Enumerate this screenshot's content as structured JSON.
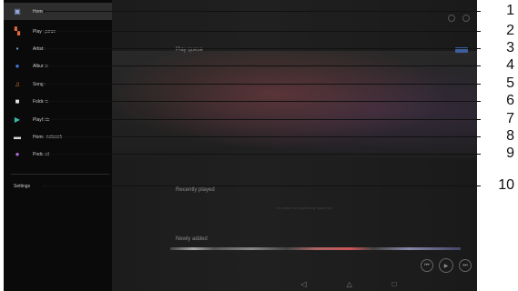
{
  "sidebar": {
    "items": [
      {
        "label": "Home",
        "icon": "home-icon",
        "color": "#8fa7d9",
        "glyph": "▣",
        "active": true
      },
      {
        "label": "Play queue",
        "icon": "play-queue-icon",
        "color": "#e06a3a",
        "glyph": "▚"
      },
      {
        "label": "Artists",
        "icon": "artists-icon",
        "color": "#7aa0e0",
        "glyph": "▪"
      },
      {
        "label": "Albums",
        "icon": "albums-icon",
        "color": "#3f7bd9",
        "glyph": "●"
      },
      {
        "label": "Songs",
        "icon": "songs-icon",
        "color": "#e07a2a",
        "glyph": "♫"
      },
      {
        "label": "Folders",
        "icon": "folders-icon",
        "color": "#e6e6e6",
        "glyph": "■"
      },
      {
        "label": "Playlists",
        "icon": "playlists-icon",
        "color": "#3fb7a8",
        "glyph": "▶"
      },
      {
        "label": "Home network",
        "icon": "home-network-icon",
        "color": "#d9d9d9",
        "glyph": "▬"
      },
      {
        "label": "Podcast",
        "icon": "podcast-icon",
        "color": "#b36bd9",
        "glyph": "●"
      }
    ],
    "settings_label": "Settings"
  },
  "main": {
    "play_queue_title": "Play queue",
    "recently_played_title": "Recently played",
    "recently_played_empty": "You have not played any music yet",
    "newly_added_title": "Newly added"
  },
  "callouts": [
    "1",
    "2",
    "3",
    "4",
    "5",
    "6",
    "7",
    "8",
    "9",
    "10"
  ],
  "navbar": {
    "back": "◁",
    "home": "△",
    "recents": "□"
  },
  "player": {
    "prev": "⏮",
    "play": "▶",
    "next": "⏭"
  }
}
